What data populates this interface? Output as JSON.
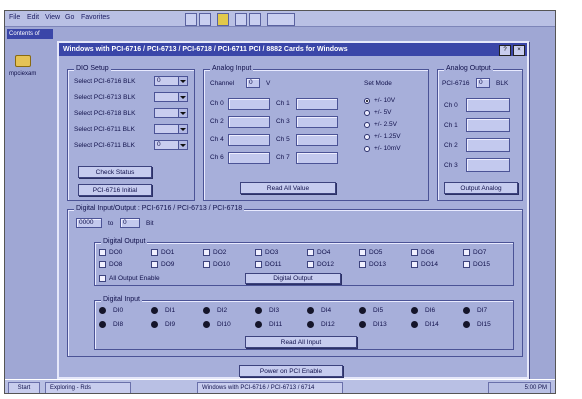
{
  "menubar": {
    "items": [
      "File",
      "Edit",
      "View",
      "Go",
      "Favorites"
    ]
  },
  "desktop": {
    "window_label": "Contents of",
    "icon_label": "mpciexam"
  },
  "dialog": {
    "title": "Windows with PCI-6716 / PCI-6713 / PCI-6718 / PCI-6711 PCI / 8882 Cards for Windows",
    "close_glyph": "×",
    "help_glyph": "?"
  },
  "dio_setup": {
    "legend": "DIO Setup",
    "rows": [
      {
        "label": "Select PCI-6716 BLK",
        "value": "0"
      },
      {
        "label": "Select PCI-6713 BLK",
        "value": ""
      },
      {
        "label": "Select PCI-6718 BLK",
        "value": ""
      },
      {
        "label": "Select PCI-6711 BLK",
        "value": ""
      },
      {
        "label": "Select PCI-6711 BLK",
        "value": "0"
      }
    ],
    "check_button": "Check Status",
    "init_button": "PCI-6716 Initial"
  },
  "analog_input": {
    "legend": "Analog Input",
    "channel_label": "Channel",
    "channel_value": "0",
    "channel_unit": "V",
    "set_mode_label": "Set Mode",
    "modes": [
      "+/- 10V",
      "+/- 5V",
      "+/- 2.5V",
      "+/- 1.25V",
      "+/- 10mV"
    ],
    "fields": [
      {
        "label": "Ch 0",
        "value": ""
      },
      {
        "label": "Ch 1",
        "value": ""
      },
      {
        "label": "Ch 2",
        "value": ""
      },
      {
        "label": "Ch 3",
        "value": ""
      },
      {
        "label": "Ch 4",
        "value": ""
      },
      {
        "label": "Ch 5",
        "value": ""
      },
      {
        "label": "Ch 6",
        "value": ""
      },
      {
        "label": "Ch 7",
        "value": ""
      }
    ],
    "read_button": "Read All Value"
  },
  "analog_output": {
    "legend": "Analog Output",
    "channel_label": "PCI-6716",
    "channel_value": "0",
    "channel_unit": "BLK",
    "fields": [
      {
        "label": "Ch 0",
        "value": ""
      },
      {
        "label": "Ch 1",
        "value": ""
      },
      {
        "label": "Ch 2",
        "value": ""
      },
      {
        "label": "Ch 3",
        "value": ""
      }
    ],
    "button": "Output Analog"
  },
  "digital_io": {
    "legend": "Digital Input/Output : PCI-6716 / PCI-6713 / PCI-6718",
    "address_value": "0000",
    "address_to": "to",
    "address_value2": "0",
    "address_unit": "Bit",
    "output_legend": "Digital Output",
    "outputs": [
      "DO0",
      "DO1",
      "DO2",
      "DO3",
      "DO4",
      "DO5",
      "DO6",
      "DO7",
      "DO8",
      "DO9",
      "DO10",
      "DO11",
      "DO12",
      "DO13",
      "DO14",
      "DO15"
    ],
    "all_output_label": "All Output Enable",
    "output_button": "Digital Output",
    "input_legend": "Digital Input",
    "inputs": [
      "DI0",
      "DI1",
      "DI2",
      "DI3",
      "DI4",
      "DI5",
      "DI6",
      "DI7",
      "DI8",
      "DI9",
      "DI10",
      "DI11",
      "DI12",
      "DI13",
      "DI14",
      "DI15"
    ],
    "input_button": "Read All Input"
  },
  "footer_button": "Power on PCI Enable",
  "taskbar": {
    "start": "Start",
    "task1": "Exploring - Rds",
    "task2": "Windows with PCI-6716 / PCI-6713 / 6714",
    "clock": "5:00 PM"
  }
}
